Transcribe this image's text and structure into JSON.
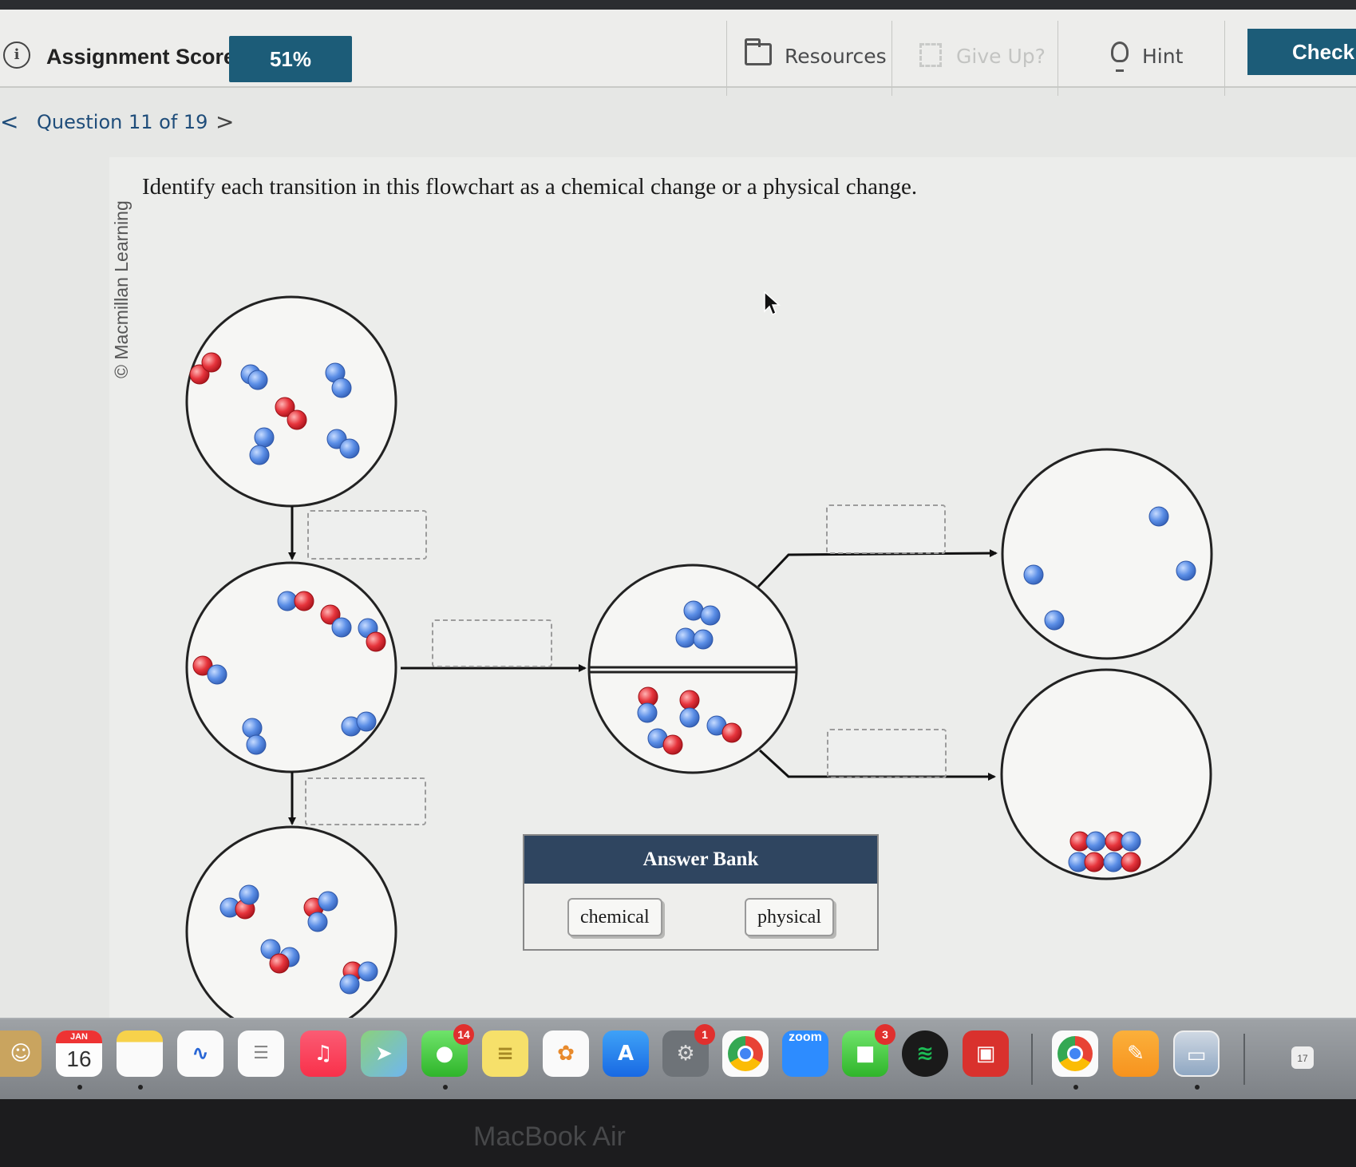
{
  "topbar": {
    "score_label": "Assignment Score:",
    "score_value": "51%",
    "resources": "Resources",
    "give_up": "Give Up?",
    "hint": "Hint",
    "check": "Check A"
  },
  "nav": {
    "prev": "<",
    "label": "Question 11 of 19",
    "next": ">"
  },
  "question": {
    "copyright": "© Macmillan Learning",
    "prompt": "Identify each transition in this flowchart as a chemical change or a physical change."
  },
  "answer_bank": {
    "title": "Answer Bank",
    "options": [
      "chemical",
      "physical"
    ]
  },
  "colors": {
    "blue_atom": "#5b8ee6",
    "red_atom": "#e6343c",
    "accent": "#1c5c78",
    "bank_header": "#2f4560"
  },
  "dock": {
    "calendar_month": "JAN",
    "calendar_day": "16",
    "badges": {
      "messages": "14",
      "settings": "1",
      "facetime": "3"
    },
    "trailing_day": "17"
  },
  "bezel": "MacBook Air"
}
